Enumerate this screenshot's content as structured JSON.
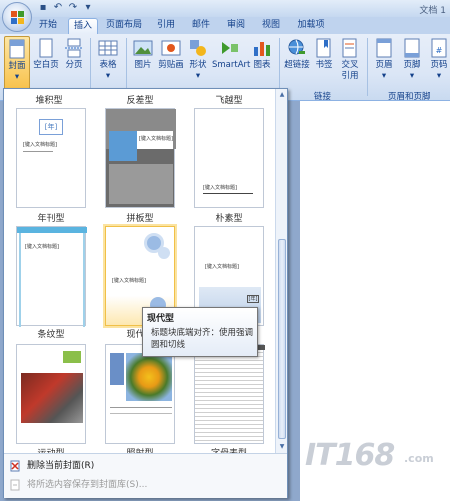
{
  "window": {
    "title": "文档 1"
  },
  "quick_access": [
    "save-icon",
    "undo-icon",
    "redo-icon",
    "customize-icon"
  ],
  "tabs": [
    {
      "label": "开始"
    },
    {
      "label": "插入"
    },
    {
      "label": "页面布局"
    },
    {
      "label": "引用"
    },
    {
      "label": "邮件"
    },
    {
      "label": "审阅"
    },
    {
      "label": "视图"
    },
    {
      "label": "加载项"
    }
  ],
  "active_tab": "插入",
  "ribbon": {
    "buttons": [
      {
        "label": "封面"
      },
      {
        "label": "空白页"
      },
      {
        "label": "分页"
      },
      {
        "label": "表格"
      },
      {
        "label": "图片"
      },
      {
        "label": "剪贴画"
      },
      {
        "label": "形状"
      },
      {
        "label": "SmartArt"
      },
      {
        "label": "图表"
      },
      {
        "label": "超链接"
      },
      {
        "label": "书签"
      },
      {
        "label": "交叉"
      },
      {
        "label": "引用"
      },
      {
        "label": "页眉"
      },
      {
        "label": "页脚"
      },
      {
        "label": "页码"
      }
    ],
    "groups": [
      {
        "label": "链接"
      },
      {
        "label": "页眉和页脚"
      }
    ]
  },
  "gallery": {
    "items": [
      {
        "name": "堆积型"
      },
      {
        "name": "反差型"
      },
      {
        "name": "飞越型"
      },
      {
        "name": "年刊型"
      },
      {
        "name": "拼板型"
      },
      {
        "name": "朴素型"
      },
      {
        "name": "条纹型"
      },
      {
        "name": "现代型"
      },
      {
        "name": "",
        "note": "partially hidden"
      },
      {
        "name": "运动型"
      },
      {
        "name": "照射型"
      },
      {
        "name": "字母表型"
      }
    ],
    "thumb_text": {
      "doc_title": "[键入文档标题]",
      "year": "[年]",
      "abstract": "[键入文档摘要]"
    },
    "menu": [
      {
        "label": "删除当前封面(R)"
      },
      {
        "label": "将所选内容保存到封面库(S)..."
      }
    ]
  },
  "tooltip": {
    "title": "现代型",
    "body1": "标题块底端对齐：使用强调",
    "body2": "圆和切线"
  },
  "watermark": {
    "text": "IT168",
    "suffix": ".com"
  },
  "colors": {
    "accent": "#f8c24c",
    "ribbon": "#dbe6f6",
    "border": "#8db2e3"
  }
}
